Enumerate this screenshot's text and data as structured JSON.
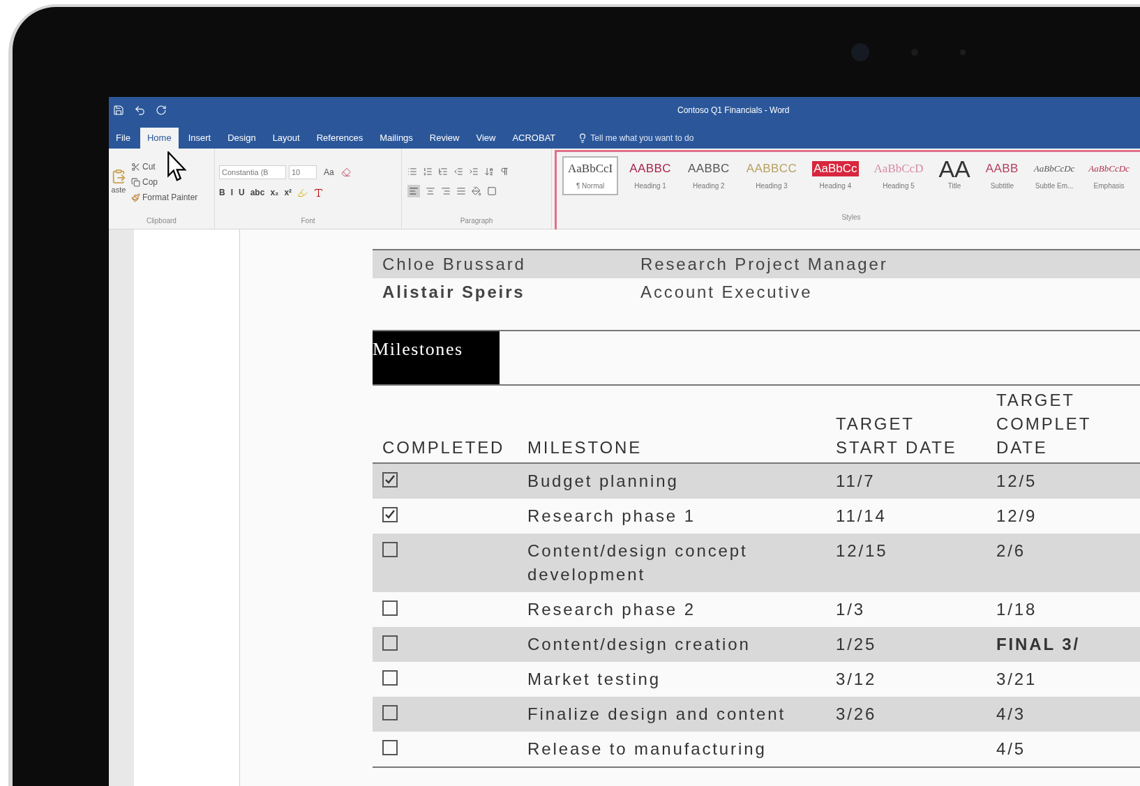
{
  "window": {
    "title": "Contoso Q1 Financials - Word"
  },
  "tabs": [
    {
      "label": "File",
      "selected": false
    },
    {
      "label": "Home",
      "selected": true
    },
    {
      "label": "Insert",
      "selected": false
    },
    {
      "label": "Design",
      "selected": false
    },
    {
      "label": "Layout",
      "selected": false
    },
    {
      "label": "References",
      "selected": false
    },
    {
      "label": "Mailings",
      "selected": false
    },
    {
      "label": "Review",
      "selected": false
    },
    {
      "label": "View",
      "selected": false
    },
    {
      "label": "ACROBAT",
      "selected": false
    }
  ],
  "tell_me": {
    "placeholder": "Tell me what you want to do"
  },
  "clipboard": {
    "paste": "aste",
    "cut": "Cut",
    "copy": "Cop",
    "format_painter": "Format Painter",
    "label": "Clipboard"
  },
  "font": {
    "family": "Constantia (B",
    "size": "10",
    "case": "Aa",
    "buttons": [
      "B",
      "I",
      "U",
      "abc",
      "x₂",
      "x²"
    ],
    "label": "Font"
  },
  "paragraph": {
    "label": "Paragraph"
  },
  "styles": {
    "label": "Styles",
    "items": [
      {
        "preview": "AaBbCcI",
        "name": "¶ Normal",
        "kind": "plain",
        "color": "#444444",
        "selected": true
      },
      {
        "preview": "AABBC",
        "name": "Heading 1",
        "kind": "bold",
        "color": "#a8234a",
        "selected": false
      },
      {
        "preview": "AABBC",
        "name": "Heading 2",
        "kind": "bold",
        "color": "#555555",
        "selected": false
      },
      {
        "preview": "AABBCC",
        "name": "Heading 3",
        "kind": "bold",
        "color": "#b8a060",
        "selected": false
      },
      {
        "preview": "AaBbCc",
        "name": "Heading 4",
        "kind": "filled",
        "color": "#d7263d",
        "selected": false
      },
      {
        "preview": "AaBbCcD",
        "name": "Heading 5",
        "kind": "plain",
        "color": "#d58aa0",
        "selected": false
      },
      {
        "preview": "AA",
        "name": "Title",
        "kind": "large",
        "color": "#333333",
        "selected": false
      },
      {
        "preview": "AABB",
        "name": "Subtitle",
        "kind": "bold",
        "color": "#b0405f",
        "selected": false
      },
      {
        "preview": "AaBbCcDc",
        "name": "Subtle Em...",
        "kind": "italic",
        "color": "#555555",
        "selected": false
      },
      {
        "preview": "AaBbCcDc",
        "name": "Emphasis",
        "kind": "italic",
        "color": "#b0304f",
        "selected": false
      }
    ]
  },
  "contacts": [
    {
      "name": "Chloe Brussard",
      "role": "Research Project Manager",
      "shaded": true,
      "bold": false
    },
    {
      "name": "Alistair Speirs",
      "role": "Account Executive",
      "shaded": false,
      "bold": true
    }
  ],
  "section_heading": "Milestones",
  "table": {
    "columns": [
      "COMPLETED",
      "MILESTONE",
      "TARGET\nSTART DATE",
      "TARGET\nCOMPLET\nDATE"
    ],
    "rows": [
      {
        "checked": true,
        "milestone": "Budget planning",
        "start": "11/7",
        "end": "12/5",
        "end_bold": false
      },
      {
        "checked": true,
        "milestone": "Research phase 1",
        "start": "11/14",
        "end": "12/9",
        "end_bold": false
      },
      {
        "checked": false,
        "milestone": "Content/design concept development",
        "start": "12/15",
        "end": "2/6",
        "end_bold": false
      },
      {
        "checked": false,
        "milestone": "Research phase 2",
        "start": "1/3",
        "end": "1/18",
        "end_bold": false
      },
      {
        "checked": false,
        "milestone": "Content/design creation",
        "start": "1/25",
        "end": "FINAL 3/",
        "end_bold": true
      },
      {
        "checked": false,
        "milestone": "Market testing",
        "start": "3/12",
        "end": "3/21",
        "end_bold": false
      },
      {
        "checked": false,
        "milestone": "Finalize design and content",
        "start": "3/26",
        "end": "4/3",
        "end_bold": false
      },
      {
        "checked": false,
        "milestone": "Release to manufacturing",
        "end": "4/5",
        "end_bold": false
      }
    ]
  }
}
